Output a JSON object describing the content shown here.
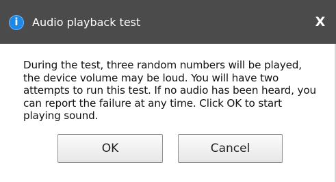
{
  "window": {
    "title": "Audio playback test",
    "icon": "info-icon",
    "close_label": "X"
  },
  "message": "During the test, three random numbers will be played, the device volume may be loud. You will have two attempts to run this test. If no audio has been heard, you can report the failure at any time. Click OK to start playing sound.",
  "buttons": {
    "ok_label": "OK",
    "cancel_label": "Cancel"
  },
  "colors": {
    "titlebar": "#4b4b4b",
    "info_icon": "#1e88e5",
    "background": "#ffffff"
  }
}
